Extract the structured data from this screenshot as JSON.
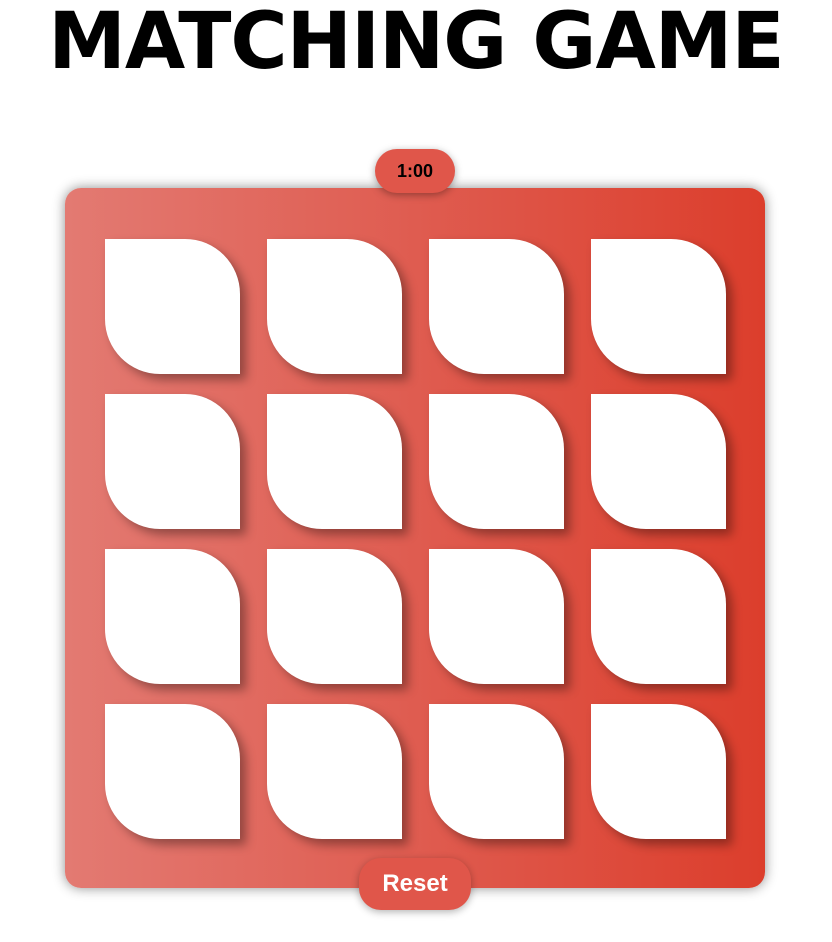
{
  "title": "MATCHING GAME",
  "timer": "1:00",
  "reset_label": "Reset",
  "colors": {
    "board_gradient_start": "#e37a72",
    "board_gradient_end": "#dc3e2c",
    "card_face_down": "#ffffff",
    "button_bg": "#e0564a"
  },
  "board": {
    "rows": 4,
    "columns": 4,
    "cards": [
      {
        "state": "face-down"
      },
      {
        "state": "face-down"
      },
      {
        "state": "face-down"
      },
      {
        "state": "face-down"
      },
      {
        "state": "face-down"
      },
      {
        "state": "face-down"
      },
      {
        "state": "face-down"
      },
      {
        "state": "face-down"
      },
      {
        "state": "face-down"
      },
      {
        "state": "face-down"
      },
      {
        "state": "face-down"
      },
      {
        "state": "face-down"
      },
      {
        "state": "face-down"
      },
      {
        "state": "face-down"
      },
      {
        "state": "face-down"
      },
      {
        "state": "face-down"
      }
    ]
  }
}
